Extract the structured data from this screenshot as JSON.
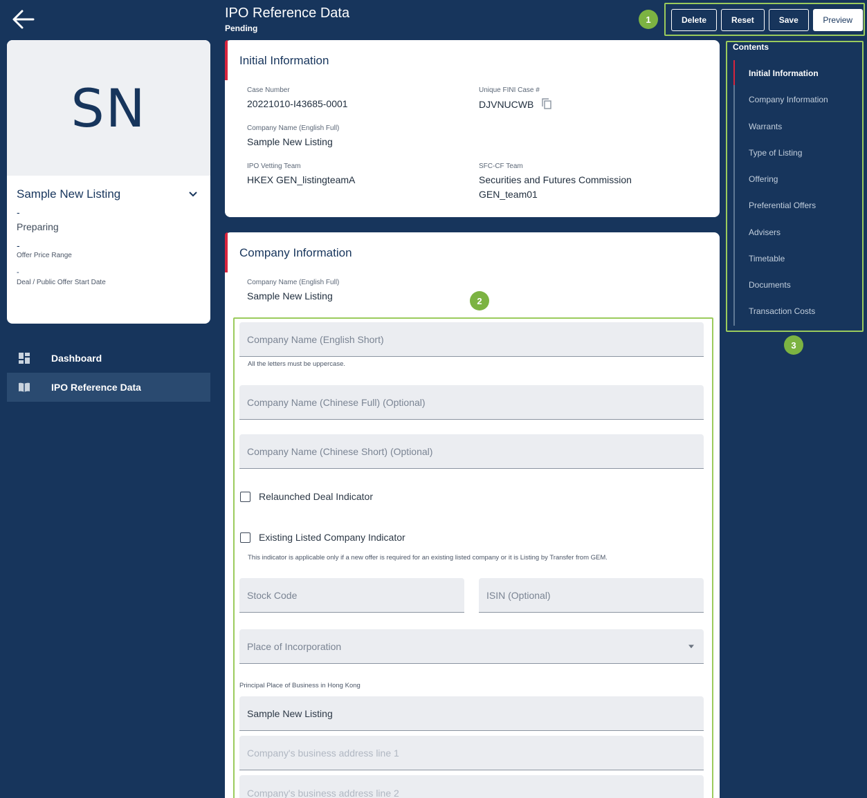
{
  "header": {
    "title": "IPO Reference Data",
    "status": "Pending"
  },
  "actions": {
    "delete": "Delete",
    "reset": "Reset",
    "save": "Save",
    "preview": "Preview"
  },
  "callouts": [
    "1",
    "2",
    "3"
  ],
  "profile": {
    "initials": "SN",
    "name": "Sample New Listing",
    "dash1": "-",
    "status": "Preparing",
    "dash2": "-",
    "offer_price_label": "Offer Price Range",
    "dash3": "-",
    "deal_date_label": "Deal / Public Offer Start Date"
  },
  "nav": {
    "dashboard": "Dashboard",
    "ipo_reference": "IPO Reference Data"
  },
  "initial_info": {
    "title": "Initial Information",
    "case_number_label": "Case Number",
    "case_number": "20221010-I43685-0001",
    "fini_label": "Unique FINI Case #",
    "fini_value": "DJVNUCWB",
    "company_name_label": "Company Name (English Full)",
    "company_name": "Sample New Listing",
    "vetting_label": "IPO Vetting Team",
    "vetting_value": "HKEX GEN_listingteamA",
    "sfc_label": "SFC-CF Team",
    "sfc_line1": "Securities and Futures Commission",
    "sfc_line2": "GEN_team01"
  },
  "company_info": {
    "title": "Company Information",
    "company_name_label": "Company Name (English Full)",
    "company_name": "Sample New Listing",
    "english_short_placeholder": "Company Name (English Short)",
    "english_short_helper": "All the letters must be uppercase.",
    "chinese_full_placeholder": "Company Name (Chinese Full) (Optional)",
    "chinese_short_placeholder": "Company Name (Chinese Short) (Optional)",
    "relaunched_label": "Relaunched Deal Indicator",
    "existing_label": "Existing Listed Company Indicator",
    "existing_helper": "This indicator is applicable only if a new offer is required for an existing listed company or it is Listing by Transfer from GEM.",
    "stock_code_placeholder": "Stock Code",
    "isin_placeholder": "ISIN (Optional)",
    "incorporation_placeholder": "Place of Incorporation",
    "principal_label": "Principal Place of Business in Hong Kong",
    "principal_value": "Sample New Listing",
    "address1_placeholder": "Company's business address line 1",
    "address2_placeholder": "Company's business address line 2"
  },
  "contents": {
    "title": "Contents",
    "items": [
      "Initial Information",
      "Company Information",
      "Warrants",
      "Type of Listing",
      "Offering",
      "Preferential Offers",
      "Advisers",
      "Timetable",
      "Documents",
      "Transaction Costs"
    ]
  }
}
